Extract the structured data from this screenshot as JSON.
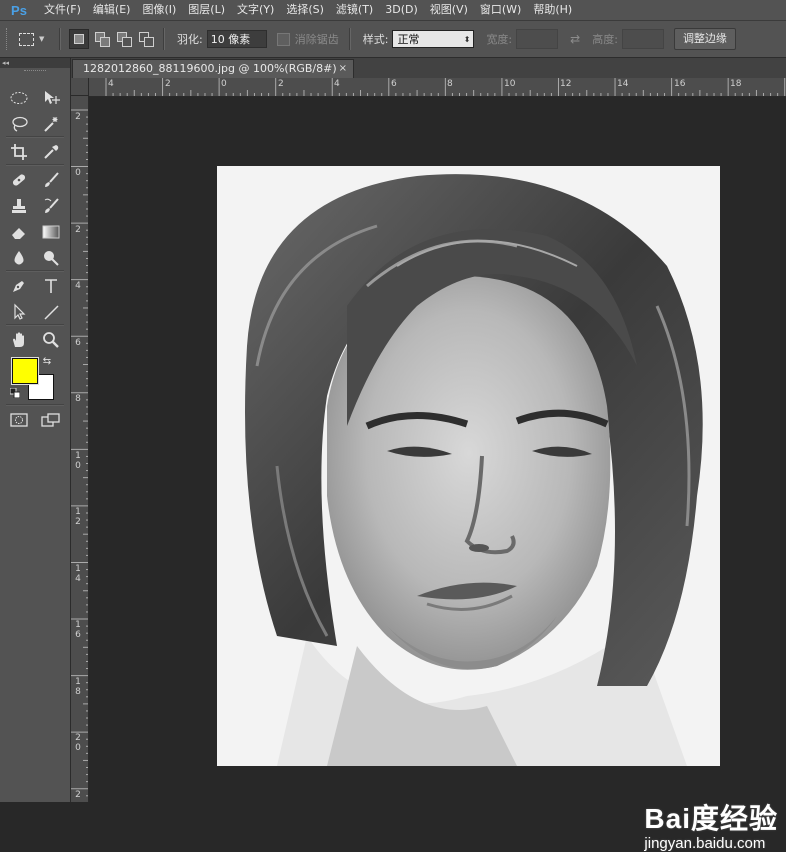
{
  "app": {
    "logo": "Ps"
  },
  "menu": [
    "文件(F)",
    "编辑(E)",
    "图像(I)",
    "图层(L)",
    "文字(Y)",
    "选择(S)",
    "滤镜(T)",
    "3D(D)",
    "视图(V)",
    "窗口(W)",
    "帮助(H)"
  ],
  "options": {
    "feather_label": "羽化:",
    "feather_value": "10 像素",
    "antialias_label": "消除锯齿",
    "style_label": "样式:",
    "style_value": "正常",
    "width_label": "宽度:",
    "height_label": "高度:",
    "refine_label": "调整边缘"
  },
  "toolbox": {
    "collapse": "◂◂"
  },
  "document": {
    "tab_title": "1282012860_88119600.jpg @ 100%(RGB/8#)",
    "close": "×"
  },
  "ruler": {
    "h_labels": [
      "4",
      "2",
      "0",
      "2",
      "4",
      "6",
      "8",
      "10",
      "12",
      "14",
      "16",
      "18"
    ],
    "v_labels": [
      "2",
      "0",
      "2",
      "4",
      "6",
      "8",
      "10",
      "12",
      "14",
      "16",
      "18",
      "20",
      "2"
    ]
  },
  "colors": {
    "foreground": "#ffff00",
    "background": "#ffffff"
  },
  "watermark": {
    "main": "Bai度经验",
    "sub": "jingyan.baidu.com"
  }
}
